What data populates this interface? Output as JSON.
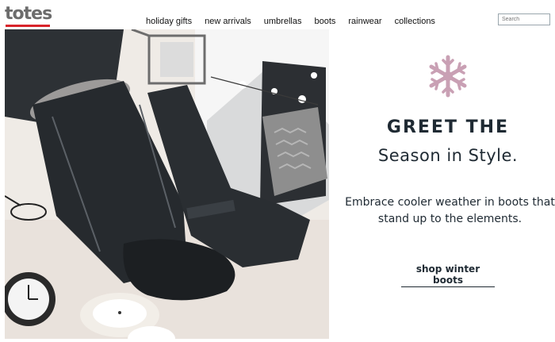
{
  "header": {
    "logo": "totes",
    "nav": [
      "holiday gifts",
      "new arrivals",
      "umbrellas",
      "boots",
      "rainwear",
      "collections"
    ],
    "search_placeholder": "Search"
  },
  "hero": {
    "headline": "GREET THE",
    "subhead": "Season in Style.",
    "body": "Embrace cooler weather in boots that stand up to the elements.",
    "cta": "shop winter boots",
    "snowflake_color": "#c9a0b4",
    "text_color": "#1f2a33"
  }
}
